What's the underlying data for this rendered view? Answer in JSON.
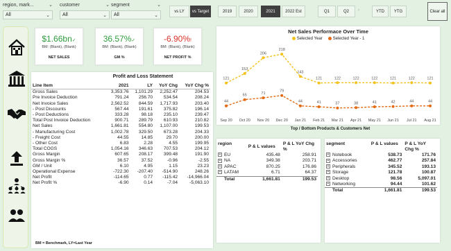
{
  "slicers": [
    {
      "label": "region, mark...",
      "value": "All"
    },
    {
      "label": "customer",
      "value": "All"
    },
    {
      "label": "segment",
      "value": "All"
    }
  ],
  "compare_buttons": [
    "vs LY",
    "vs Target"
  ],
  "year_buttons": [
    "2019",
    "2020",
    "2021",
    "2022 Est"
  ],
  "quarter_buttons": [
    "Q1",
    "Q2"
  ],
  "period_buttons": [
    "YTD",
    "YTG"
  ],
  "clear_all": "Clear all",
  "kpis": [
    {
      "value": "$1.66bn",
      "mark": "✓",
      "bm": "BM: (Blank), (Blank)",
      "label": "NET SALES",
      "color": "#2e9c3c"
    },
    {
      "value": "36.57%",
      "mark": "✓",
      "bm": "BM: (Blank), (Blank)",
      "label": "GM %",
      "color": "#2e9c3c"
    },
    {
      "value": "-6.90%",
      "mark": "!",
      "bm": "BM: (Blank), (Blank)",
      "label": "NET PROFIT %",
      "color": "#d9342b"
    }
  ],
  "pl": {
    "title": "Profit and Loss Statement",
    "columns": [
      "Line Item",
      "2021",
      "LY",
      "YoY Chg",
      "YoY Chg %"
    ],
    "rows": [
      [
        "Gross Sales",
        "3,353.76",
        "1,101.29",
        "2,252.47",
        "204.53"
      ],
      [
        "Pre Invoice Deduction",
        "791.24",
        "256.70",
        "534.54",
        "208.24"
      ],
      [
        "Net Invoice Sales",
        "2,562.52",
        "844.59",
        "1,717.93",
        "203.40"
      ],
      [
        "- Post Discounts",
        "567.44",
        "191.61",
        "375.82",
        "196.14"
      ],
      [
        "- Post Deductions",
        "333.28",
        "98.18",
        "235.10",
        "239.47"
      ],
      [
        "Total Post Invoice Deduction",
        "900.71",
        "289.79",
        "610.93",
        "210.82"
      ],
      [
        "Net Sales",
        "1,661.81",
        "554.80",
        "1,107.00",
        "199.53"
      ],
      [
        "- Manufacturing Cost",
        "1,002.78",
        "329.50",
        "673.28",
        "204.33"
      ],
      [
        "- Freight Cost",
        "44.55",
        "14.85",
        "29.70",
        "200.00"
      ],
      [
        "- Other Cost",
        "6.83",
        "2.28",
        "4.55",
        "199.95"
      ],
      [
        "Total COGS",
        "1,054.16",
        "346.63",
        "707.53",
        "204.12"
      ],
      [
        "Gross Margin",
        "607.65",
        "208.17",
        "399.48",
        "191.90"
      ],
      [
        "Gross Margin %",
        "36.57",
        "37.52",
        "-0.96",
        "-2.55"
      ],
      [
        "GM / Unit",
        "6.10",
        "4.95",
        "1.15",
        "23.23"
      ],
      [
        "Operational Expense",
        "-722.30",
        "-207.40",
        "-514.90",
        "248.26"
      ],
      [
        "Net Profit",
        "-114.65",
        "0.77",
        "-115.42",
        "-14,966.04"
      ],
      [
        "Net Profit %",
        "-6.90",
        "0.14",
        "-7.04",
        "-5,063.10"
      ]
    ],
    "footnote": "BM = Benchmark, LY=Last Year"
  },
  "chart_data": {
    "type": "line",
    "title": "Net Sales Performace Over Time",
    "categories": [
      "Sep 20",
      "Oct 20",
      "Nov 20",
      "Dec 20",
      "Jan 21",
      "Feb 21",
      "Mar 21",
      "Apr 21",
      "May 21",
      "Jun 21",
      "Jul 21",
      "Aug 21"
    ],
    "series": [
      {
        "name": "Selected Year",
        "color": "#f2c21d",
        "values": [
          121,
          153,
          206,
          218,
          143,
          121,
          122,
          122,
          122,
          121,
          122,
          121
        ]
      },
      {
        "name": "Selected Year - 1",
        "color": "#e46a12",
        "values": [
          44,
          65,
          71,
          79,
          44,
          41,
          37,
          38,
          41,
          42,
          44,
          44
        ]
      }
    ],
    "grid": false
  },
  "subtitle_products": "Top / Bottom Products & Customers Net",
  "region_table": {
    "columns": [
      "region",
      "P & L values",
      "P & L YoY Chg %"
    ],
    "rows": [
      [
        "EU",
        "435.48",
        "258.91"
      ],
      [
        "NA",
        "349.38",
        "203.71"
      ],
      [
        "APAC",
        "870.25",
        "176.86"
      ],
      [
        "LATAM",
        "6.71",
        "64.37"
      ]
    ],
    "total": [
      "Total",
      "1,661.81",
      "199.53"
    ]
  },
  "segment_table": {
    "columns": [
      "segment",
      "P & L values",
      "P & L YoY Chg %"
    ],
    "rows": [
      [
        "Notebook",
        "538.73",
        "171.76"
      ],
      [
        "Accessories",
        "462.77",
        "257.84"
      ],
      [
        "Peripherals",
        "345.52",
        "193.13"
      ],
      [
        "Storage",
        "121.78",
        "100.87"
      ],
      [
        "Desktop",
        "98.56",
        "5,097.01"
      ],
      [
        "Networking",
        "94.44",
        "101.62"
      ]
    ],
    "total": [
      "Total",
      "1,661.81",
      "199.53"
    ]
  }
}
